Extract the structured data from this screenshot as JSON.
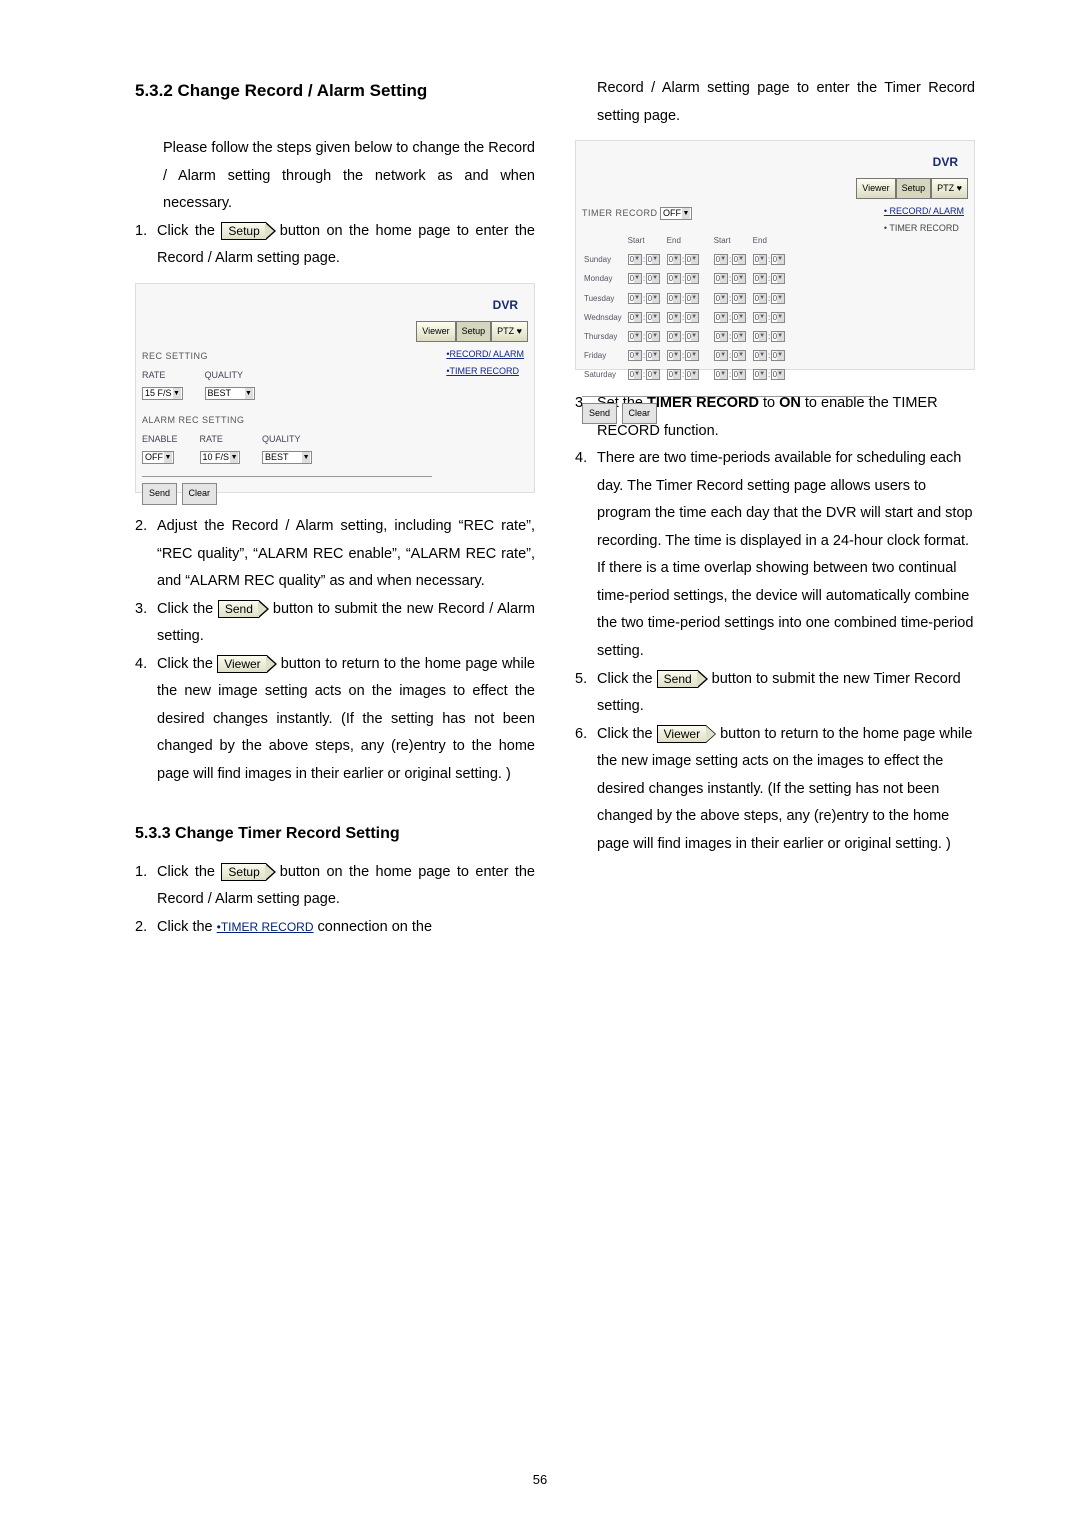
{
  "section532": {
    "heading": "5.3.2 Change Record / Alarm Setting",
    "intro": "Please follow the steps given below to change the Record / Alarm setting through the network as and when necessary.",
    "step1_pre": "Click the",
    "step1_btn": "Setup",
    "step1_post": "button on the home page to enter the Record / Alarm setting page.",
    "step2": "Adjust the Record / Alarm setting, including “REC rate”, “REC quality”, “ALARM REC enable”, “ALARM REC rate”, and “ALARM REC quality” as and when necessary.",
    "step3_pre": "Click the",
    "step3_btn": "Send",
    "step3_post": "button to submit the new Record / Alarm setting.",
    "step4_pre": "Click the",
    "step4_btn": "Viewer",
    "step4_post": "button to return to the home page while the new image setting acts on the images to effect the desired changes instantly. (If the setting has not been changed by the above steps, any (re)entry to the home page will find images in their earlier or original setting. )"
  },
  "section533": {
    "heading": "5.3.3 Change Timer Record Setting",
    "step1_pre": "Click the",
    "step1_btn": "Setup",
    "step1_post": "button on the home page to enter the Record / Alarm setting page.",
    "step2_pre": "Click the",
    "step2_link": "•TIMER RECORD",
    "step2_post": "connection on the",
    "cont": "Record / Alarm setting page to enter the Timer Record setting page.",
    "step3_a": "Set the ",
    "step3_b": "TIMER RECORD",
    "step3_c": " to ",
    "step3_d": "ON",
    "step3_e": " to enable the TIMER RECORD function.",
    "step4": "There are two time-periods available for scheduling each day. The Timer Record setting page allows users to program the time each day that the DVR will start and stop recording. The time is displayed in a 24-hour clock format. If there is a time overlap showing between two continual time-period settings, the device will automatically combine the two time-period settings into one combined time-period setting.",
    "step5_pre": "Click the",
    "step5_btn": "Send",
    "step5_post": "button to submit the new Timer Record setting.",
    "step6_pre": "Click the",
    "step6_btn": "Viewer",
    "step6_post": "button to return to the home page while the new image setting acts on the images to effect the desired changes instantly. (If the setting has not been changed by the above steps, any (re)entry to the home page will find images in their earlier or original setting. )"
  },
  "shot1": {
    "title": "DVR",
    "tabs": [
      "Viewer",
      "Setup",
      "PTZ ♥"
    ],
    "rec_setting": "REC SETTING",
    "rate": "RATE",
    "rate_val": "15 F/S",
    "quality": "QUALITY",
    "quality_val": "BEST",
    "alarm_rec_setting": "ALARM REC SETTING",
    "enable": "ENABLE",
    "enable_val": "OFF",
    "arate": "RATE",
    "arate_val": "10 F/S",
    "aquality": "QUALITY",
    "aquality_val": "BEST",
    "links": [
      "•RECORD/ ALARM",
      "•TIMER RECORD"
    ],
    "send": "Send",
    "clear": "Clear"
  },
  "shot2": {
    "title": "DVR",
    "tabs": [
      "Viewer",
      "Setup",
      "PTZ ♥"
    ],
    "tr": "TIMER RECORD",
    "tr_val": "OFF",
    "cols": [
      "Start",
      "End",
      "Start",
      "End"
    ],
    "days": [
      "Sunday",
      "Monday",
      "Tuesday",
      "Wednsday",
      "Thursday",
      "Friday",
      "Saturday"
    ],
    "cell_h": "0",
    "cell_m": "00",
    "links": [
      "• RECORD/ ALARM",
      "• TIMER RECORD"
    ],
    "send": "Send",
    "clear": "Clear"
  },
  "page_number": "56"
}
